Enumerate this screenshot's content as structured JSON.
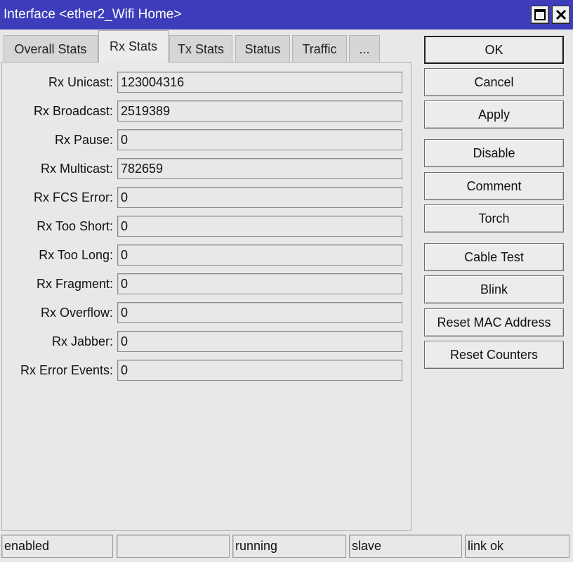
{
  "window": {
    "title": "Interface <ether2_Wifi Home>"
  },
  "tabs": [
    {
      "label": "Overall Stats",
      "active": false
    },
    {
      "label": "Rx Stats",
      "active": true
    },
    {
      "label": "Tx Stats",
      "active": false
    },
    {
      "label": "Status",
      "active": false
    },
    {
      "label": "Traffic",
      "active": false
    },
    {
      "label": "...",
      "active": false
    }
  ],
  "fields": [
    {
      "label": "Rx Unicast:",
      "value": "123004316"
    },
    {
      "label": "Rx Broadcast:",
      "value": "2519389"
    },
    {
      "label": "Rx Pause:",
      "value": "0"
    },
    {
      "label": "Rx Multicast:",
      "value": "782659"
    },
    {
      "label": "Rx FCS Error:",
      "value": "0"
    },
    {
      "label": "Rx Too Short:",
      "value": "0"
    },
    {
      "label": "Rx Too Long:",
      "value": "0"
    },
    {
      "label": "Rx Fragment:",
      "value": "0"
    },
    {
      "label": "Rx Overflow:",
      "value": "0"
    },
    {
      "label": "Rx Jabber:",
      "value": "0"
    },
    {
      "label": "Rx Error Events:",
      "value": "0"
    }
  ],
  "buttons": {
    "ok": "OK",
    "cancel": "Cancel",
    "apply": "Apply",
    "disable": "Disable",
    "comment": "Comment",
    "torch": "Torch",
    "cable_test": "Cable Test",
    "blink": "Blink",
    "reset_mac": "Reset MAC Address",
    "reset_counters": "Reset Counters"
  },
  "status_bar": [
    "enabled",
    "",
    "running",
    "slave",
    "link ok"
  ],
  "colors": {
    "title_bar": "#3d3dbb",
    "background": "#e8e8e8"
  },
  "icons": {
    "maximize": "maximize-icon",
    "close": "close-icon"
  }
}
